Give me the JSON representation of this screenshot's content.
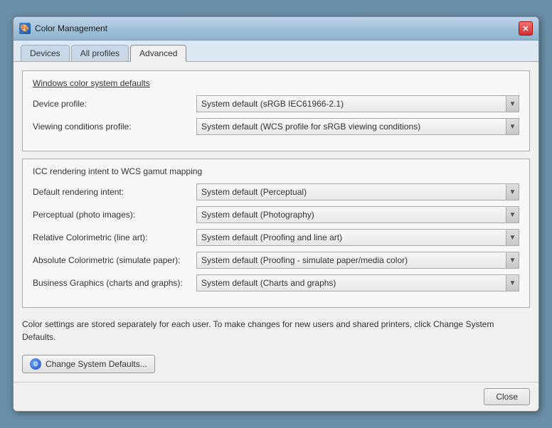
{
  "window": {
    "title": "Color Management",
    "icon": "🎨"
  },
  "tabs": [
    {
      "id": "devices",
      "label": "Devices",
      "active": false
    },
    {
      "id": "all-profiles",
      "label": "All profiles",
      "active": false
    },
    {
      "id": "advanced",
      "label": "Advanced",
      "active": true
    }
  ],
  "section1": {
    "title": "Windows color system defaults",
    "fields": [
      {
        "label": "Device profile:",
        "value": "System default (sRGB IEC61966-2.1)"
      },
      {
        "label": "Viewing conditions profile:",
        "value": "System default (WCS profile for sRGB viewing conditions)"
      }
    ]
  },
  "section2": {
    "title": "ICC  rendering intent to WCS gamut mapping",
    "fields": [
      {
        "label": "Default rendering intent:",
        "value": "System default (Perceptual)"
      },
      {
        "label": "Perceptual (photo images):",
        "value": "System default (Photography)"
      },
      {
        "label": "Relative Colorimetric (line art):",
        "value": "System default (Proofing and line art)"
      },
      {
        "label": "Absolute Colorimetric (simulate paper):",
        "value": "System default (Proofing - simulate paper/media color)"
      },
      {
        "label": "Business Graphics (charts and graphs):",
        "value": "System default (Charts and graphs)"
      }
    ]
  },
  "info_text": "Color settings are stored separately for each user. To make changes for new users and shared printers, click Change System Defaults.",
  "change_defaults_button": "Change System Defaults...",
  "close_button": "Close"
}
